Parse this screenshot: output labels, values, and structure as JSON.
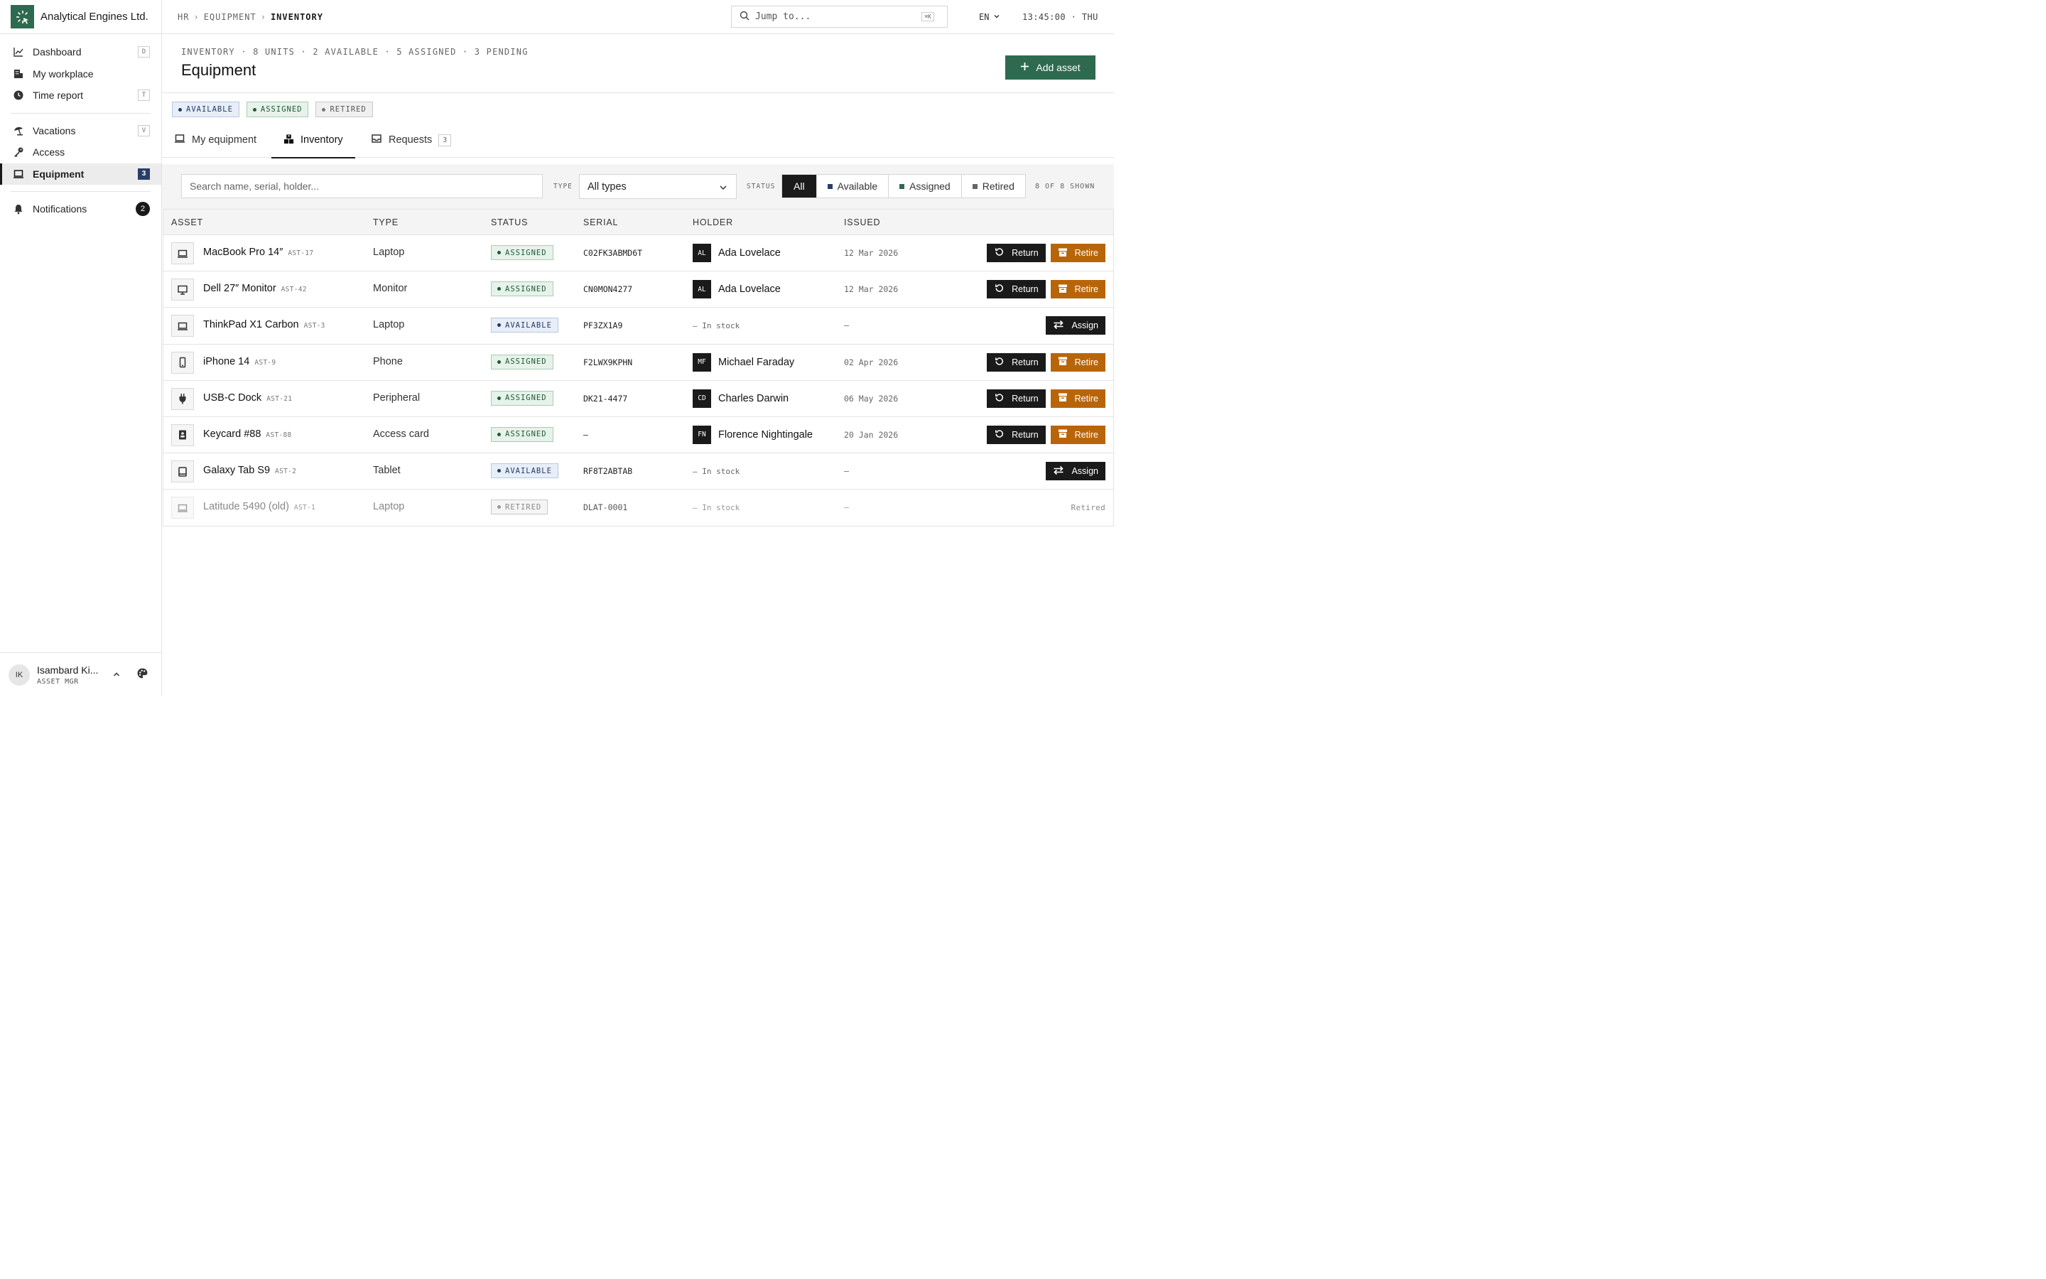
{
  "brand": {
    "name": "Analytical Engines Ltd.",
    "color": "#2d6a4f"
  },
  "nav": {
    "items": [
      {
        "label": "Dashboard",
        "key": "D",
        "icon": "chart-line-icon"
      },
      {
        "label": "My workplace",
        "icon": "building-icon"
      },
      {
        "label": "Time report",
        "key": "T",
        "icon": "clock-icon"
      },
      {
        "label": "Vacations",
        "key": "V",
        "icon": "beach-umbrella-icon"
      },
      {
        "label": "Access",
        "icon": "key-icon"
      },
      {
        "label": "Equipment",
        "count": "3",
        "icon": "laptop-icon",
        "active": true
      },
      {
        "label": "Notifications",
        "badge": "2",
        "icon": "bell-icon"
      }
    ]
  },
  "user": {
    "initials": "IK",
    "name": "Isambard Ki...",
    "role": "ASSET MGR"
  },
  "topbar": {
    "breadcrumbs": [
      "HR",
      "EQUIPMENT",
      "INVENTORY"
    ],
    "jump_placeholder": "Jump to...",
    "jump_shortcut": "⌘K",
    "language": "EN",
    "clock": "13:45:00 · THU"
  },
  "header": {
    "summary": "INVENTORY · 8 UNITS · 2 AVAILABLE · 5 ASSIGNED · 3 PENDING",
    "title": "Equipment",
    "add_button": "Add asset"
  },
  "legend": [
    "AVAILABLE",
    "ASSIGNED",
    "RETIRED"
  ],
  "tabs": [
    {
      "label": "My equipment",
      "icon": "laptop-icon"
    },
    {
      "label": "Inventory",
      "icon": "boxes-icon",
      "active": true
    },
    {
      "label": "Requests",
      "icon": "inbox-icon",
      "count": "3"
    }
  ],
  "filters": {
    "search_placeholder": "Search name, serial, holder...",
    "type_label": "TYPE",
    "type_value": "All types",
    "status_label": "STATUS",
    "status_options": [
      "All",
      "Available",
      "Assigned",
      "Retired"
    ],
    "shown": "8 OF 8 SHOWN"
  },
  "table": {
    "columns": [
      "ASSET",
      "TYPE",
      "STATUS",
      "SERIAL",
      "HOLDER",
      "ISSUED"
    ],
    "rows": [
      {
        "icon": "laptop-icon",
        "name": "MacBook Pro 14″",
        "tag": "AST-17",
        "type": "Laptop",
        "status": "ASSIGNED",
        "serial": "C02FK3ABMD6T",
        "holder_initials": "AL",
        "holder": "Ada Lovelace",
        "issued": "12 Mar 2026",
        "actions": [
          "Return",
          "Retire"
        ]
      },
      {
        "icon": "monitor-icon",
        "name": "Dell 27″ Monitor",
        "tag": "AST-42",
        "type": "Monitor",
        "status": "ASSIGNED",
        "serial": "CN0MON4277",
        "holder_initials": "AL",
        "holder": "Ada Lovelace",
        "issued": "12 Mar 2026",
        "actions": [
          "Return",
          "Retire"
        ]
      },
      {
        "icon": "laptop-icon",
        "name": "ThinkPad X1 Carbon",
        "tag": "AST-3",
        "type": "Laptop",
        "status": "AVAILABLE",
        "serial": "PF3ZX1A9",
        "holder": "— In stock",
        "issued": "—",
        "actions": [
          "Assign"
        ]
      },
      {
        "icon": "phone-icon",
        "name": "iPhone 14",
        "tag": "AST-9",
        "type": "Phone",
        "status": "ASSIGNED",
        "serial": "F2LWX9KPHN",
        "holder_initials": "MF",
        "holder": "Michael Faraday",
        "issued": "02 Apr 2026",
        "actions": [
          "Return",
          "Retire"
        ]
      },
      {
        "icon": "plug-icon",
        "name": "USB-C Dock",
        "tag": "AST-21",
        "type": "Peripheral",
        "status": "ASSIGNED",
        "serial": "DK21-4477",
        "holder_initials": "CD",
        "holder": "Charles Darwin",
        "issued": "06 May 2026",
        "actions": [
          "Return",
          "Retire"
        ]
      },
      {
        "icon": "id-card-icon",
        "name": "Keycard #88",
        "tag": "AST-88",
        "type": "Access card",
        "status": "ASSIGNED",
        "serial": "—",
        "holder_initials": "FN",
        "holder": "Florence Nightingale",
        "issued": "20 Jan 2026",
        "actions": [
          "Return",
          "Retire"
        ]
      },
      {
        "icon": "tablet-icon",
        "name": "Galaxy Tab S9",
        "tag": "AST-2",
        "type": "Tablet",
        "status": "AVAILABLE",
        "serial": "RF8T2ABTAB",
        "holder": "— In stock",
        "issued": "—",
        "actions": [
          "Assign"
        ]
      },
      {
        "icon": "laptop-icon",
        "name": "Latitude 5490 (old)",
        "tag": "AST-1",
        "type": "Laptop",
        "status": "RETIRED",
        "serial": "DLAT-0001",
        "holder": "— In stock",
        "issued": "—",
        "retired_note": "Retired"
      }
    ]
  },
  "colors": {
    "accent": "#2d6a4f",
    "retire": "#b8650a",
    "available": "#223b66",
    "assigned": "#1f5a36"
  }
}
